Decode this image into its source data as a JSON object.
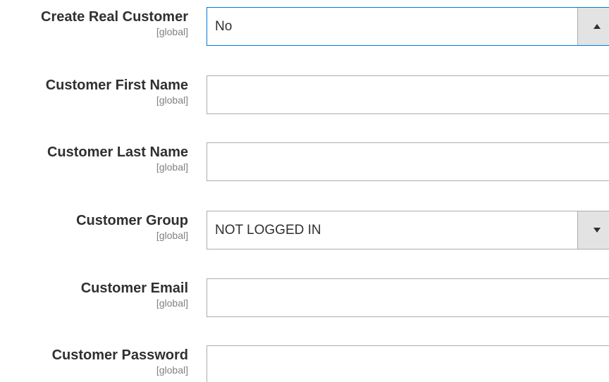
{
  "form": {
    "rows": [
      {
        "label": "Create Real Customer",
        "scope": "[global]",
        "type": "select",
        "value": "No",
        "icon": "arrow-up-icon",
        "state": "open"
      },
      {
        "label": "Customer First Name",
        "scope": "[global]",
        "type": "text",
        "value": ""
      },
      {
        "label": "Customer Last Name",
        "scope": "[global]",
        "type": "text",
        "value": ""
      },
      {
        "label": "Customer Group",
        "scope": "[global]",
        "type": "select",
        "value": "NOT LOGGED IN",
        "icon": "arrow-down-icon",
        "state": "closed"
      },
      {
        "label": "Customer Email",
        "scope": "[global]",
        "type": "text",
        "value": ""
      },
      {
        "label": "Customer Password",
        "scope": "[global]",
        "type": "password",
        "value": ""
      }
    ]
  },
  "colors": {
    "focus_border": "#007bdb",
    "field_border": "#adadad",
    "toggle_bg": "#e3e3e3",
    "label_text": "#303030",
    "scope_text": "#808080"
  }
}
